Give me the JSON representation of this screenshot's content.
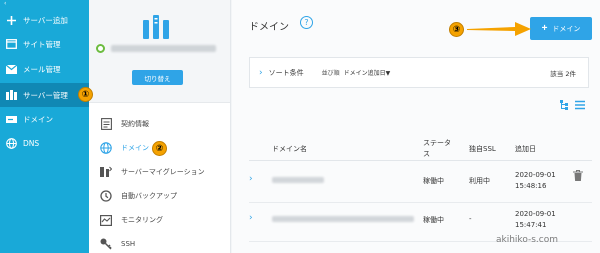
{
  "nav": {
    "items": [
      {
        "label": "サーバー追加",
        "icon": "plus-icon"
      },
      {
        "label": "サイト管理",
        "icon": "window-icon"
      },
      {
        "label": "メール管理",
        "icon": "mail-icon"
      },
      {
        "label": "サーバー管理",
        "icon": "server-icon",
        "active": true
      },
      {
        "label": "ドメイン",
        "icon": "domain-icon"
      },
      {
        "label": "DNS",
        "icon": "globe-icon"
      }
    ]
  },
  "server": {
    "switch_label": "切り替え"
  },
  "menu": {
    "items": [
      {
        "label": "契約情報",
        "icon": "contract-icon"
      },
      {
        "label": "ドメイン",
        "icon": "globe-icon",
        "active": true
      },
      {
        "label": "サーバーマイグレーション",
        "icon": "migration-icon"
      },
      {
        "label": "自動バックアップ",
        "icon": "backup-icon"
      },
      {
        "label": "モニタリング",
        "icon": "monitor-icon"
      },
      {
        "label": "SSH",
        "icon": "key-icon"
      }
    ]
  },
  "main": {
    "title": "ドメイン",
    "help": "?",
    "add_button": "ドメイン",
    "sort": {
      "label": "ソート条件",
      "order_label": "並び順",
      "order_value": "ドメイン追加日▼",
      "count": "該当 2件"
    },
    "columns": {
      "domain": "ドメイン名",
      "status_line1": "ステータ",
      "status_line2": "ス",
      "ssl": "独自SSL",
      "added": "追加日"
    },
    "rows": [
      {
        "status": "稼働中",
        "ssl": "利用中",
        "date": "2020-09-01",
        "time": "15:48:16"
      },
      {
        "status": "稼働中",
        "ssl": "-",
        "date": "2020-09-01",
        "time": "15:47:41"
      }
    ]
  },
  "annotations": {
    "badge1": "①",
    "badge2": "②",
    "badge3": "③",
    "watermark": "akihiko-s.com"
  },
  "colors": {
    "nav_bg": "#19a9d8",
    "nav_active": "#1088b4",
    "accent": "#2fa4e7",
    "badge": "#f5a200"
  }
}
